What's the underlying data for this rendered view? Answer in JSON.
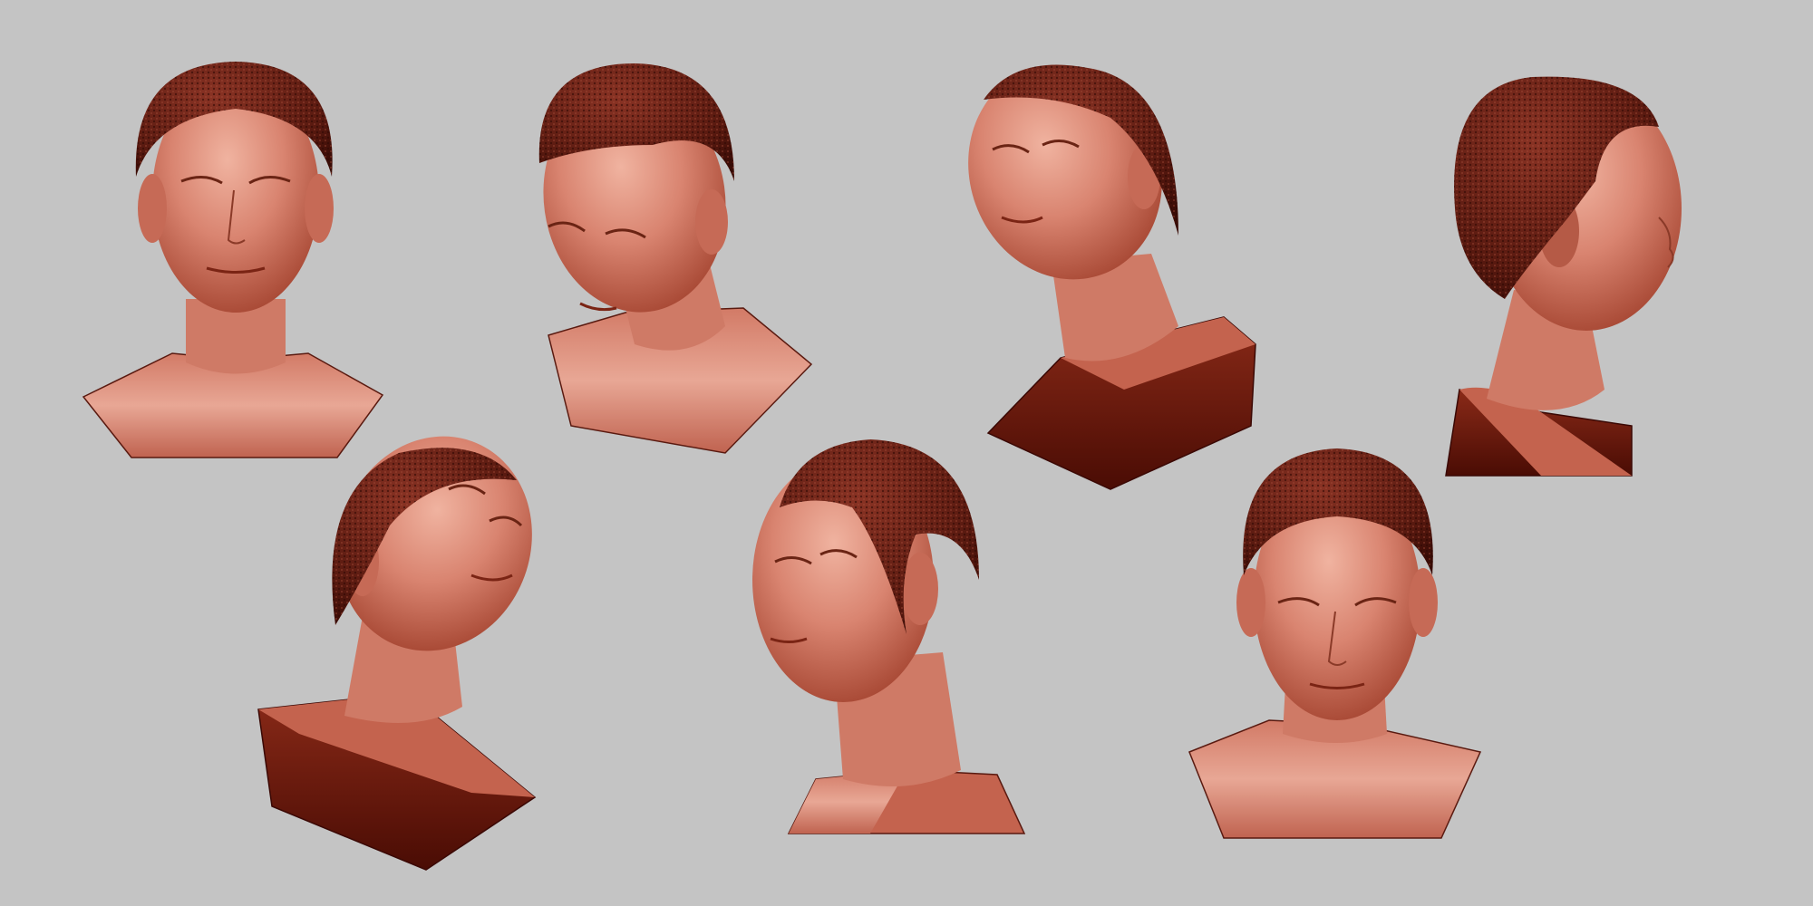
{
  "scene": {
    "background": "#c4c4c4",
    "clay_light": "#e2a392",
    "clay_mid": "#c8705e",
    "clay_dark": "#7a2010",
    "hair": "#5a1a10",
    "busts": [
      {
        "view": "front"
      },
      {
        "view": "three-quarter-down-right"
      },
      {
        "view": "three-quarter-up-left"
      },
      {
        "view": "right-profile"
      },
      {
        "view": "low-angle-up-right"
      },
      {
        "view": "left-three-quarter"
      },
      {
        "view": "front-low-angle"
      }
    ]
  }
}
